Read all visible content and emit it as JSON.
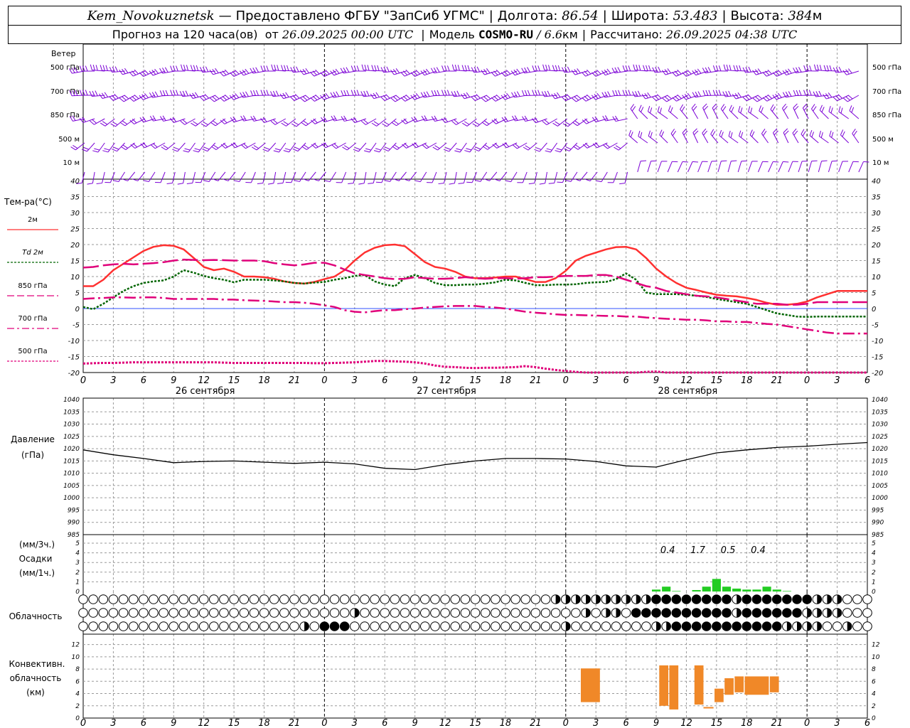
{
  "header": {
    "station": "Kem_Novokuznetsk",
    "dash": "—",
    "provider": "Предоставлено ФГБУ \"ЗапСиб УГМС\"",
    "lon_label": "Долгота:",
    "lon_value": "86.54",
    "lat_label": "Широта:",
    "lat_value": "53.483",
    "alt_label": "Высота:",
    "alt_value": "384",
    "alt_unit": "м",
    "forecast_label": "Прогноз на 120 часа(ов)  от",
    "forecast_from": "26.09.2025 00:00 UTC",
    "model_label": "Модель",
    "model_name": "COSMO-RU",
    "model_res": "/ 6.6",
    "model_unit": "км",
    "calc_label": "Рассчитано:",
    "calc_value": "26.09.2025 04:38 UTC"
  },
  "labels": {
    "wind": "Ветер",
    "wind_levels": [
      "500 гПа",
      "700 гПа",
      "850 гПа",
      "500 м",
      "10 м"
    ],
    "temp_title": "Тем-ра(°C)",
    "legend": [
      {
        "text": "2м",
        "color": "#ff3030",
        "dash": "solid"
      },
      {
        "text": "Td  2м",
        "color": "#006400",
        "dash": "dotted"
      },
      {
        "text": "850 гПа",
        "color": "#e0007a",
        "dash": "long"
      },
      {
        "text": "700 гПа",
        "color": "#e0007a",
        "dash": "dashdot"
      },
      {
        "text": "500 гПа",
        "color": "#e0007a",
        "dash": "dotted"
      }
    ],
    "pressure_title": "Давление",
    "pressure_unit": "(гПа)",
    "precip_unit_top": "(мм/3ч.)",
    "precip_title": "Осадки",
    "precip_unit_bottom": "(мм/1ч.)",
    "cloud_title": "Облачность",
    "conv_title_1": "Конвективн.",
    "conv_title_2": "облачность",
    "conv_unit": "(км)",
    "days": [
      "26 сентября",
      "27 сентября",
      "28 сентября"
    ],
    "hour_ticks": [
      "0",
      "3",
      "6",
      "9",
      "12",
      "15",
      "18",
      "21",
      "0",
      "3",
      "6",
      "9",
      "12",
      "15",
      "18",
      "21",
      "0",
      "3",
      "6",
      "9",
      "12",
      "15",
      "18",
      "21",
      "0",
      "3",
      "6"
    ]
  },
  "colors": {
    "wind": "#7b00d6",
    "t2m": "#ff3030",
    "td2m": "#006400",
    "t850": "#e0007a",
    "zero_line": "#3050ff",
    "pressure": "#000000",
    "precip": "#22cc22",
    "conv": "#f08828",
    "grid": "#9a9a9a"
  },
  "chart_data": [
    {
      "type": "line",
      "name_ref": "temperature",
      "x_hours": [
        0,
        1,
        2,
        3,
        4,
        5,
        6,
        7,
        8,
        9,
        10,
        11,
        12,
        13,
        14,
        15,
        16,
        17,
        18,
        19,
        20,
        21,
        22,
        23,
        24,
        25,
        26,
        27,
        28,
        29,
        30,
        31,
        32,
        33,
        34,
        35,
        36,
        37,
        38,
        39,
        40,
        41,
        42,
        43,
        44,
        45,
        46,
        47,
        48,
        49,
        50,
        51,
        52,
        53,
        54,
        55,
        56,
        57,
        58,
        59,
        60,
        61,
        62,
        63,
        64,
        65,
        66,
        67,
        68,
        69,
        70,
        71,
        72,
        73,
        74,
        75,
        76,
        77,
        78
      ],
      "ylim": [
        -20,
        40
      ],
      "yticks": [
        -20,
        -15,
        -10,
        -5,
        0,
        5,
        10,
        15,
        20,
        25,
        30,
        35,
        40
      ],
      "series": [
        {
          "key": "t2m",
          "values": [
            7,
            7,
            9,
            12,
            14,
            16,
            18,
            19.3,
            19.8,
            19.6,
            18.5,
            15.8,
            13,
            12,
            12.5,
            11.5,
            10,
            10,
            9.8,
            9.3,
            8.5,
            8,
            7.8,
            8.3,
            9.2,
            10,
            12,
            15,
            17.5,
            19,
            19.8,
            20,
            19.5,
            17,
            14.5,
            13,
            12.5,
            11.5,
            10,
            9.5,
            9.5,
            9.7,
            10,
            10,
            9.2,
            8.3,
            8.3,
            9.5,
            11.8,
            15,
            16.5,
            17.5,
            18.5,
            19.2,
            19.3,
            18.5,
            15.8,
            12.5,
            10,
            8,
            6.5,
            5.8,
            5,
            4.3,
            4,
            3.8,
            3.3,
            2.7,
            1.8,
            1.2,
            1.2,
            1.5,
            2.2,
            3.5,
            4.5,
            5.5,
            5.5,
            5.5,
            5.5
          ]
        },
        {
          "key": "td2m",
          "values": [
            0.5,
            -0.2,
            1.5,
            3.5,
            5.5,
            7,
            8,
            8.5,
            8.8,
            10,
            12,
            11.2,
            10.2,
            9.5,
            9,
            8.2,
            9,
            9,
            9,
            8.8,
            8.5,
            8,
            7.8,
            8.1,
            8.3,
            9,
            9.5,
            10.2,
            10.5,
            8.5,
            7.5,
            7,
            9.5,
            10.5,
            9.5,
            8,
            7.3,
            7.3,
            7.5,
            7.5,
            7.8,
            8.2,
            9,
            8.8,
            8,
            7.3,
            7.3,
            7.5,
            7.5,
            7.6,
            8,
            8.2,
            8.3,
            9.2,
            11,
            9,
            5,
            4.5,
            4.5,
            4.5,
            4.3,
            4,
            3.6,
            3,
            2.5,
            2,
            1.5,
            0.5,
            -0.5,
            -1.5,
            -2,
            -2.5,
            -2.6,
            -2.5,
            -2.5,
            -2.5,
            -2.5,
            -2.5,
            -2.5
          ]
        },
        {
          "key": "t850",
          "values": [
            12.8,
            13,
            13.5,
            13.8,
            14,
            13.8,
            14,
            14.2,
            14.5,
            15,
            15.3,
            15.2,
            15.1,
            15.2,
            15.1,
            15,
            15,
            15,
            14.8,
            14.2,
            13.8,
            13.5,
            13.8,
            14.3,
            14.3,
            13.5,
            12.2,
            11,
            10.5,
            10,
            9.5,
            9.2,
            9.3,
            9.8,
            9.5,
            9.3,
            9.3,
            9.5,
            9.8,
            9.5,
            9.3,
            9.5,
            9.5,
            9.3,
            9.5,
            9.8,
            9.8,
            10,
            10.2,
            10.2,
            10.2,
            10.5,
            10.5,
            10,
            9,
            8,
            7,
            6.5,
            5.5,
            5,
            4.5,
            4,
            3.8,
            3.5,
            3,
            2.5,
            2,
            1.5,
            1.5,
            1.5,
            1.2,
            1.2,
            1.5,
            2,
            2,
            2,
            2,
            2,
            2
          ]
        },
        {
          "key": "t700",
          "values": [
            3,
            3.2,
            3.3,
            3.5,
            3.5,
            3.4,
            3.5,
            3.5,
            3.3,
            3,
            3,
            3,
            3,
            3,
            2.8,
            2.8,
            2.6,
            2.5,
            2.4,
            2.2,
            2,
            2,
            1.8,
            1.5,
            1,
            0.5,
            -0.5,
            -1,
            -1.2,
            -0.8,
            -0.5,
            -0.5,
            -0.2,
            0,
            0.3,
            0.5,
            0.7,
            0.8,
            0.8,
            0.8,
            0.5,
            0.3,
            0,
            -0.5,
            -1,
            -1.3,
            -1.5,
            -1.8,
            -2,
            -2,
            -2.1,
            -2.2,
            -2.3,
            -2.3,
            -2.5,
            -2.5,
            -2.8,
            -3,
            -3.2,
            -3.3,
            -3.5,
            -3.5,
            -3.7,
            -4,
            -4,
            -4.2,
            -4.2,
            -4.5,
            -4.8,
            -5,
            -5.5,
            -6,
            -6.5,
            -7,
            -7.5,
            -7.8,
            -7.8,
            -7.8,
            -7.8
          ]
        },
        {
          "key": "t500",
          "values": [
            -17.2,
            -17.1,
            -17,
            -17,
            -16.9,
            -16.8,
            -16.8,
            -16.8,
            -16.8,
            -16.8,
            -16.8,
            -16.8,
            -16.8,
            -16.8,
            -16.9,
            -17,
            -17,
            -17,
            -17,
            -17,
            -17,
            -17,
            -17,
            -17.1,
            -17.1,
            -17,
            -16.9,
            -16.8,
            -16.6,
            -16.4,
            -16.4,
            -16.5,
            -16.6,
            -16.8,
            -17.2,
            -17.8,
            -18.2,
            -18.3,
            -18.5,
            -18.6,
            -18.5,
            -18.5,
            -18.4,
            -18.3,
            -18,
            -18.3,
            -18.8,
            -19.2,
            -19.5,
            -19.8,
            -20,
            -20.2,
            -20.5,
            -20.6,
            -20.6,
            -20.2,
            -19.8,
            -19.7,
            -20.2,
            -20.5,
            -20.6,
            -20.8,
            -21,
            -21.2,
            -21.5,
            -21.5,
            -21.5,
            -21.5,
            -21.5,
            -21.5,
            -21.5,
            -21.5,
            -21.5,
            -21.5,
            -21.5,
            -21.5,
            -21.5,
            -21.5,
            -21.5
          ]
        }
      ]
    },
    {
      "type": "line",
      "name_ref": "pressure",
      "ylim": [
        985,
        1040
      ],
      "yticks": [
        985,
        990,
        995,
        1000,
        1005,
        1010,
        1015,
        1020,
        1025,
        1030,
        1035,
        1040
      ],
      "x_hours": [
        0,
        3,
        6,
        9,
        12,
        15,
        18,
        21,
        24,
        27,
        30,
        33,
        36,
        39,
        42,
        45,
        48,
        51,
        54,
        57,
        60,
        63,
        66,
        69,
        72,
        75,
        78
      ],
      "values": [
        1019.5,
        1017.5,
        1016,
        1014.3,
        1014.8,
        1015,
        1014.5,
        1014,
        1014.5,
        1013.8,
        1012,
        1011.5,
        1013.5,
        1015,
        1016,
        1016,
        1015.8,
        1014.8,
        1013,
        1012.5,
        1015.5,
        1018.3,
        1019.5,
        1020.5,
        1021,
        1021.8,
        1022.5
      ]
    },
    {
      "type": "bar",
      "name_ref": "precipitation",
      "ylim": [
        0,
        5
      ],
      "yticks": [
        0,
        1,
        2,
        3,
        4,
        5
      ],
      "x_hours": [
        57,
        58,
        59,
        61,
        62,
        63,
        64,
        65,
        66,
        67,
        68,
        69,
        70
      ],
      "values": [
        0.2,
        0.5,
        0.05,
        0.15,
        0.5,
        1.3,
        0.5,
        0.3,
        0.2,
        0.2,
        0.5,
        0.2,
        0.05
      ],
      "labels_3h": [
        {
          "hour": 58,
          "text": "0.4"
        },
        {
          "hour": 61,
          "text": "1.7"
        },
        {
          "hour": 64,
          "text": "0.5"
        },
        {
          "hour": 67,
          "text": "0.4"
        }
      ]
    },
    {
      "type": "table",
      "name_ref": "cloudiness",
      "x_hours_step": 1,
      "rows": [
        {
          "level": "high",
          "filled_ranges": [
            [
              56.5,
              73.5
            ]
          ],
          "partial_hours": [
            47,
            48,
            49,
            50,
            51,
            52,
            53,
            54,
            55,
            56,
            65,
            73,
            74,
            75
          ]
        },
        {
          "level": "middle",
          "filled_ranges": [
            [
              54.5,
              75
            ]
          ],
          "partial_hours": [
            27,
            50,
            52,
            53,
            65,
            72,
            73,
            74,
            75
          ]
        },
        {
          "level": "low",
          "filled_ranges": [
            [
              23.5,
              26.5
            ],
            [
              58.5,
              70.5
            ]
          ],
          "partial_hours": [
            22,
            48,
            57,
            58,
            70,
            71,
            72,
            73,
            76
          ]
        }
      ]
    },
    {
      "type": "bar",
      "name_ref": "convective",
      "ylim": [
        0,
        13
      ],
      "yticks": [
        0,
        2,
        4,
        6,
        8,
        10,
        12
      ],
      "boxes": [
        {
          "x0": 49.5,
          "x1": 51.4,
          "y0": 2.6,
          "y1": 8.1
        },
        {
          "x0": 57.3,
          "x1": 58.2,
          "y0": 2.0,
          "y1": 8.6
        },
        {
          "x0": 58.3,
          "x1": 59.2,
          "y0": 1.4,
          "y1": 8.6
        },
        {
          "x0": 60.8,
          "x1": 61.7,
          "y0": 2.2,
          "y1": 8.6
        },
        {
          "x0": 61.7,
          "x1": 62.7,
          "y0": 1.6,
          "y1": 1.8
        },
        {
          "x0": 62.8,
          "x1": 63.7,
          "y0": 2.6,
          "y1": 4.8
        },
        {
          "x0": 63.8,
          "x1": 64.7,
          "y0": 3.8,
          "y1": 6.5
        },
        {
          "x0": 64.8,
          "x1": 65.7,
          "y0": 4.2,
          "y1": 6.8
        },
        {
          "x0": 65.8,
          "x1": 68.2,
          "y0": 3.8,
          "y1": 6.8
        },
        {
          "x0": 68.3,
          "x1": 69.2,
          "y0": 4.2,
          "y1": 6.8
        }
      ]
    }
  ]
}
